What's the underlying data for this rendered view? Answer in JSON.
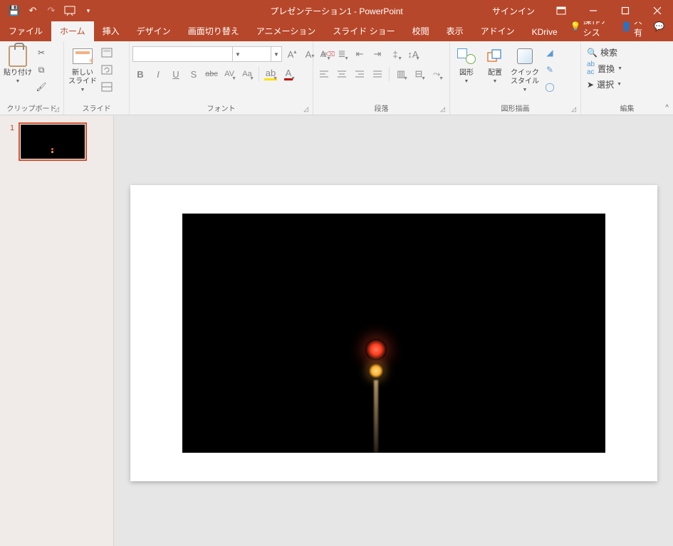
{
  "titlebar": {
    "title": "プレゼンテーション1 - PowerPoint",
    "signin": "サインイン"
  },
  "qat": {
    "save": "💾",
    "undo": "↶",
    "redo": "↷",
    "start": "▷",
    "more": "▾"
  },
  "tabs": {
    "file": "ファイル",
    "home": "ホーム",
    "insert": "挿入",
    "design": "デザイン",
    "transitions": "画面切り替え",
    "animations": "アニメーション",
    "slideshow": "スライド ショー",
    "review": "校閲",
    "view": "表示",
    "addins": "アドイン",
    "kdrive": "KDrive",
    "tell": "操作アシス",
    "share": "共有"
  },
  "ribbon": {
    "clipboard": {
      "label": "クリップボード",
      "paste": "貼り付け"
    },
    "slides": {
      "label": "スライド",
      "new": "新しい\nスライド"
    },
    "font": {
      "label": "フォント",
      "bold": "B",
      "italic": "I",
      "underline": "U",
      "shadow": "S",
      "strike": "abc",
      "spacing": "AV",
      "case": "Aa"
    },
    "paragraph": {
      "label": "段落"
    },
    "drawing": {
      "label": "図形描画",
      "shapes": "図形",
      "arrange": "配置",
      "quick": "クイック\nスタイル"
    },
    "editing": {
      "label": "編集",
      "find": "検索",
      "replace": "置換",
      "select": "選択"
    }
  },
  "panel": {
    "slide1": "1"
  }
}
